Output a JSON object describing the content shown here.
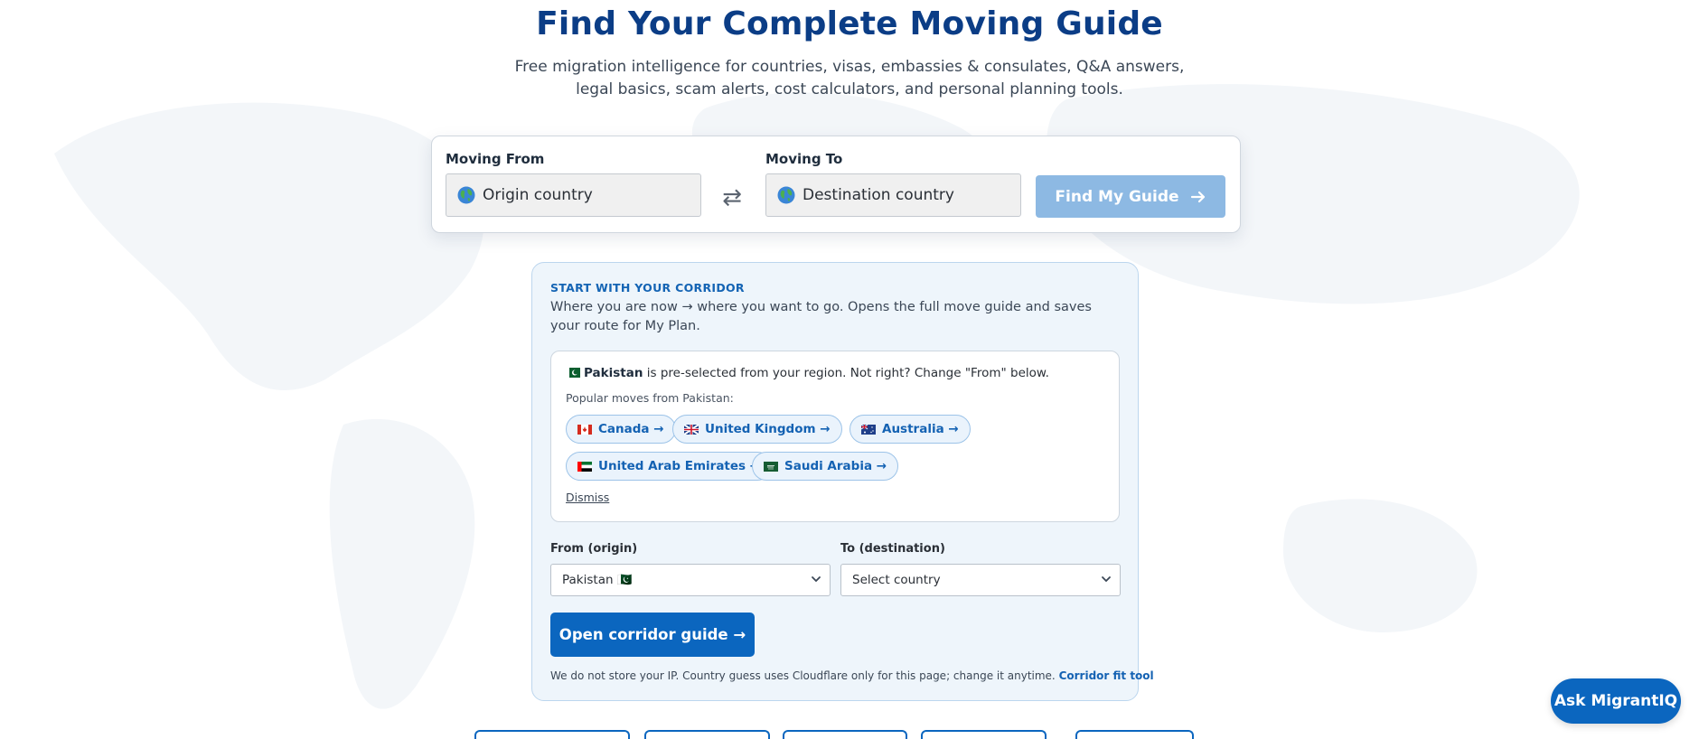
{
  "hero": {
    "title": "Find Your Complete Moving Guide",
    "subtitle": "Free migration intelligence for countries, visas, embassies & consulates, Q&A answers, legal basics, scam alerts, cost calculators, and personal planning tools."
  },
  "search": {
    "from_label": "Moving From",
    "from_placeholder": "Origin country",
    "to_label": "Moving To",
    "to_placeholder": "Destination country",
    "swap_symbol": "⇄",
    "find_button": "Find My Guide",
    "find_button_state": "disabled"
  },
  "corridor": {
    "eyebrow": "START WITH YOUR CORRIDOR",
    "description": "Where you are now → where you want to go. Opens the full move guide and saves your route for My Plan.",
    "preselect": {
      "country": "Pakistan",
      "message": " is pre-selected from your region. Not right? Change \"From\" below.",
      "popular_label": "Popular moves from Pakistan:",
      "chips": [
        {
          "label": "Canada →",
          "flag": "flag-canada"
        },
        {
          "label": "United Kingdom →",
          "flag": "flag-united-kingdom"
        },
        {
          "label": "Australia →",
          "flag": "flag-australia"
        },
        {
          "label": "United Arab Emirates →",
          "flag": "flag-uae"
        },
        {
          "label": "Saudi Arabia →",
          "flag": "flag-saudi-arabia"
        }
      ],
      "dismiss": "Dismiss"
    },
    "from_select_label": "From (origin)",
    "from_select_value": "Pakistan 🇵🇰",
    "to_select_label": "To (destination)",
    "to_select_value": "Select country",
    "open_button": "Open corridor guide →",
    "privacy_text": "We do not store your IP. Country guess uses Cloudflare only for this page; change it anytime.",
    "privacy_link": "Corridor fit tool"
  },
  "assistant": {
    "button": "Ask MigrantIQ"
  },
  "colors": {
    "title": "#0b3d86",
    "primary": "#0b66bf",
    "primary_disabled": "#8db9e3",
    "link": "#1462b3",
    "card_bg": "#eef5fb"
  }
}
